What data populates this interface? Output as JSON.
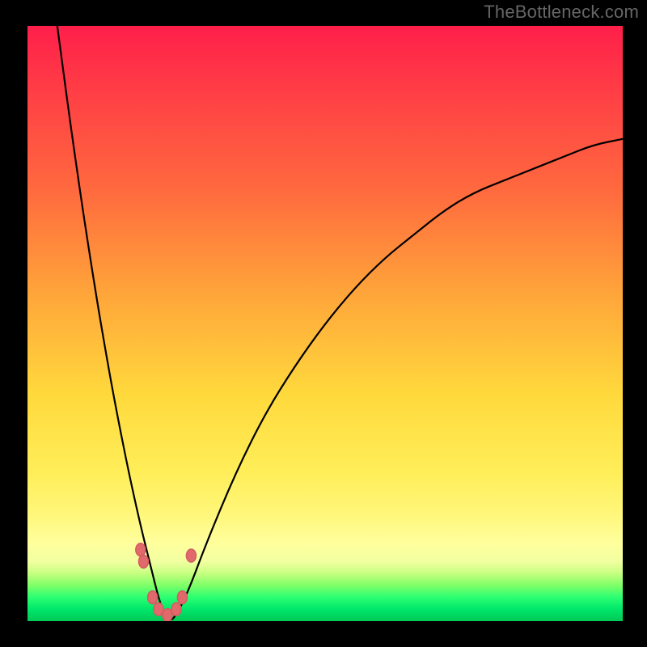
{
  "watermark": "TheBottleneck.com",
  "colors": {
    "background": "#000000",
    "gradient_top": "#ff1f4a",
    "gradient_mid1": "#ff6b3e",
    "gradient_mid2": "#ffd93c",
    "gradient_mid3": "#ffff9e",
    "gradient_bottom": "#00c956",
    "curve": "#000000",
    "markers": "#e06a6b"
  },
  "chart_data": {
    "type": "line",
    "title": "",
    "xlabel": "",
    "ylabel": "",
    "xlim": [
      0,
      100
    ],
    "ylim": [
      0,
      100
    ],
    "grid": false,
    "legend": false,
    "notes": "V-shaped bottleneck curve over red-to-green gradient. Y values estimated from vertical position (top=100, bottom=0). Left branch descends steeply from (~5,100) to trough (~23,0); right branch rises with decreasing slope toward (~100,81). Markers cluster near the trough.",
    "series": [
      {
        "name": "curve",
        "x": [
          5,
          7,
          9,
          11,
          13,
          15,
          17,
          19,
          21,
          22,
          23,
          24,
          25,
          27,
          30,
          35,
          40,
          45,
          50,
          55,
          60,
          65,
          70,
          75,
          80,
          85,
          90,
          95,
          100
        ],
        "y": [
          100,
          85,
          71,
          58,
          46,
          35,
          25,
          16,
          8,
          4,
          1,
          0,
          1,
          5,
          13,
          25,
          35,
          43,
          50,
          56,
          61,
          65,
          69,
          72,
          74,
          76,
          78,
          80,
          81
        ]
      }
    ],
    "markers": [
      {
        "x": 19.0,
        "y": 12.0
      },
      {
        "x": 19.5,
        "y": 10.0
      },
      {
        "x": 21.0,
        "y": 4.0
      },
      {
        "x": 22.0,
        "y": 2.0
      },
      {
        "x": 23.5,
        "y": 1.0
      },
      {
        "x": 25.0,
        "y": 2.0
      },
      {
        "x": 26.0,
        "y": 4.0
      },
      {
        "x": 27.5,
        "y": 11.0
      }
    ]
  }
}
